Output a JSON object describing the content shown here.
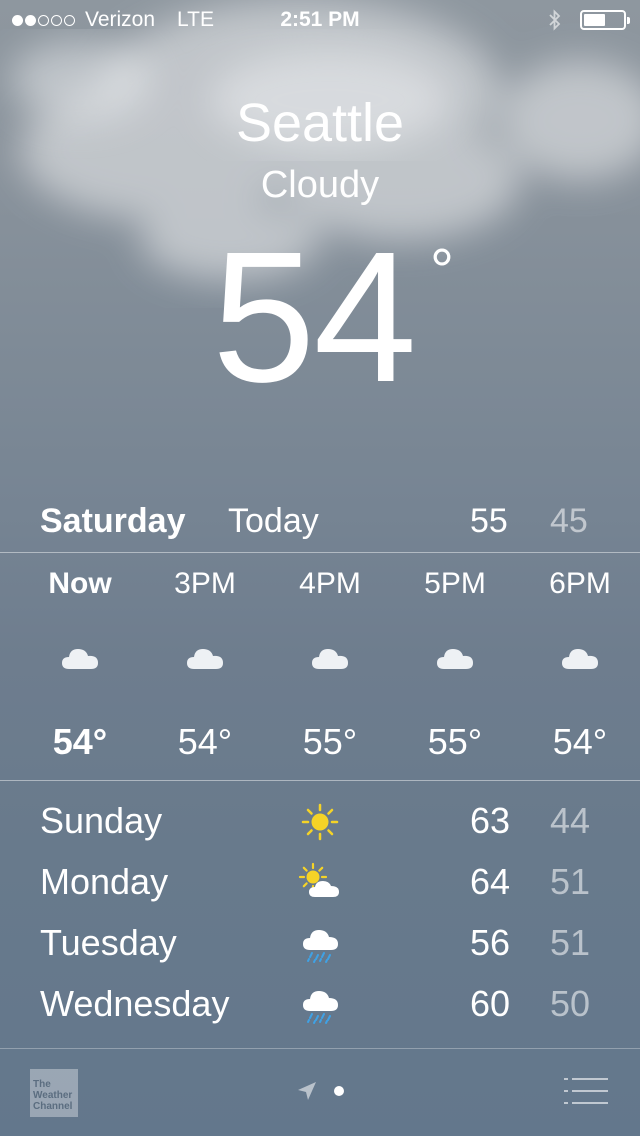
{
  "status_bar": {
    "carrier": "Verizon",
    "network": "LTE",
    "time": "2:51 PM",
    "signal_bars": 2,
    "signal_total": 5,
    "battery_level": 0.55
  },
  "location": {
    "city": "Seattle",
    "condition": "Cloudy",
    "temperature": "54",
    "degree_symbol": "°"
  },
  "today": {
    "day": "Saturday",
    "label": "Today",
    "high": "55",
    "low": "45"
  },
  "hourly": [
    {
      "time": "Now",
      "icon": "cloud-icon",
      "temp": "54°"
    },
    {
      "time": "3PM",
      "icon": "cloud-icon",
      "temp": "54°"
    },
    {
      "time": "4PM",
      "icon": "cloud-icon",
      "temp": "55°"
    },
    {
      "time": "5PM",
      "icon": "cloud-icon",
      "temp": "55°"
    },
    {
      "time": "6PM",
      "icon": "cloud-icon",
      "temp": "54°"
    }
  ],
  "daily": [
    {
      "day": "Sunday",
      "icon": "sun-icon",
      "high": "63",
      "low": "44"
    },
    {
      "day": "Monday",
      "icon": "partly-cloudy-icon",
      "high": "64",
      "low": "51"
    },
    {
      "day": "Tuesday",
      "icon": "rain-icon",
      "high": "56",
      "low": "51"
    },
    {
      "day": "Wednesday",
      "icon": "rain-icon",
      "high": "60",
      "low": "50"
    }
  ],
  "toolbar": {
    "logo_line1": "The",
    "logo_line2": "Weather",
    "logo_line3": "Channel",
    "location_icon": "location-arrow-icon",
    "list_icon": "list-icon"
  },
  "colors": {
    "sun": "#f5d327",
    "rain": "#3fa2e6",
    "low_temp": "rgba(255,255,255,0.55)"
  }
}
